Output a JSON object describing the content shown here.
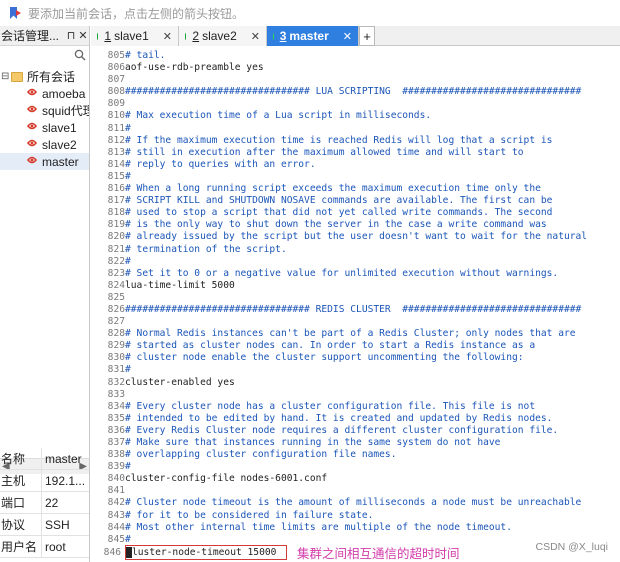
{
  "topbar": {
    "hint": "要添加当前会话，点击左侧的箭头按钮。"
  },
  "panel": {
    "title": "会话管理...",
    "pin": "⊓",
    "close": "✕",
    "root_label": "所有会话",
    "sessions": [
      "amoeba",
      "squid代理",
      "slave1",
      "slave2",
      "master"
    ],
    "props": [
      {
        "key": "名称",
        "value": "master"
      },
      {
        "key": "主机",
        "value": "192.1..."
      },
      {
        "key": "端口",
        "value": "22"
      },
      {
        "key": "协议",
        "value": "SSH"
      },
      {
        "key": "用户名",
        "value": "root"
      }
    ]
  },
  "tabs": [
    {
      "num": "1",
      "label": "slave1"
    },
    {
      "num": "2",
      "label": "slave2"
    },
    {
      "num": "3",
      "label": "master"
    }
  ],
  "tab_add": "+",
  "editor": {
    "lines": [
      {
        "n": "805",
        "t": "# tail.",
        "c": true
      },
      {
        "n": "806",
        "t": "aof-use-rdb-preamble yes",
        "c": false
      },
      {
        "n": "807",
        "t": "",
        "c": false
      },
      {
        "n": "808",
        "t": "################################ LUA SCRIPTING  ###############################",
        "c": true
      },
      {
        "n": "809",
        "t": "",
        "c": false
      },
      {
        "n": "810",
        "t": "# Max execution time of a Lua script in milliseconds.",
        "c": true
      },
      {
        "n": "811",
        "t": "#",
        "c": true
      },
      {
        "n": "812",
        "t": "# If the maximum execution time is reached Redis will log that a script is",
        "c": true
      },
      {
        "n": "813",
        "t": "# still in execution after the maximum allowed time and will start to",
        "c": true
      },
      {
        "n": "814",
        "t": "# reply to queries with an error.",
        "c": true
      },
      {
        "n": "815",
        "t": "#",
        "c": true
      },
      {
        "n": "816",
        "t": "# When a long running script exceeds the maximum execution time only the",
        "c": true
      },
      {
        "n": "817",
        "t": "# SCRIPT KILL and SHUTDOWN NOSAVE commands are available. The first can be",
        "c": true
      },
      {
        "n": "818",
        "t": "# used to stop a script that did not yet called write commands. The second",
        "c": true
      },
      {
        "n": "819",
        "t": "# is the only way to shut down the server in the case a write command was",
        "c": true
      },
      {
        "n": "820",
        "t": "# already issued by the script but the user doesn't want to wait for the natural",
        "c": true
      },
      {
        "n": "821",
        "t": "# termination of the script.",
        "c": true
      },
      {
        "n": "822",
        "t": "#",
        "c": true
      },
      {
        "n": "823",
        "t": "# Set it to 0 or a negative value for unlimited execution without warnings.",
        "c": true
      },
      {
        "n": "824",
        "t": "lua-time-limit 5000",
        "c": false
      },
      {
        "n": "825",
        "t": "",
        "c": false
      },
      {
        "n": "826",
        "t": "################################ REDIS CLUSTER  ###############################",
        "c": true
      },
      {
        "n": "827",
        "t": "",
        "c": false
      },
      {
        "n": "828",
        "t": "# Normal Redis instances can't be part of a Redis Cluster; only nodes that are",
        "c": true
      },
      {
        "n": "829",
        "t": "# started as cluster nodes can. In order to start a Redis instance as a",
        "c": true
      },
      {
        "n": "830",
        "t": "# cluster node enable the cluster support uncommenting the following:",
        "c": true
      },
      {
        "n": "831",
        "t": "#",
        "c": true
      },
      {
        "n": "832",
        "t": "cluster-enabled yes",
        "c": false
      },
      {
        "n": "833",
        "t": "",
        "c": false
      },
      {
        "n": "834",
        "t": "# Every cluster node has a cluster configuration file. This file is not",
        "c": true
      },
      {
        "n": "835",
        "t": "# intended to be edited by hand. It is created and updated by Redis nodes.",
        "c": true
      },
      {
        "n": "836",
        "t": "# Every Redis Cluster node requires a different cluster configuration file.",
        "c": true
      },
      {
        "n": "837",
        "t": "# Make sure that instances running in the same system do not have",
        "c": true
      },
      {
        "n": "838",
        "t": "# overlapping cluster configuration file names.",
        "c": true
      },
      {
        "n": "839",
        "t": "#",
        "c": true
      },
      {
        "n": "840",
        "t": "cluster-config-file nodes-6001.conf",
        "c": false
      },
      {
        "n": "841",
        "t": "",
        "c": false
      },
      {
        "n": "842",
        "t": "# Cluster node timeout is the amount of milliseconds a node must be unreachable",
        "c": true
      },
      {
        "n": "843",
        "t": "# for it to be considered in failure state.",
        "c": true
      },
      {
        "n": "844",
        "t": "# Most other internal time limits are multiple of the node timeout.",
        "c": true
      },
      {
        "n": "845",
        "t": "#",
        "c": true
      }
    ],
    "last_line_num": "846",
    "last_line_text": "luster-node-timeout 15000",
    "last_line_cursor_char": "c",
    "annotation": "集群之间相互通信的超时时间",
    "watermark": "CSDN @X_luqi"
  },
  "colors": {
    "comment": "#1c56b8",
    "active_tab": "#2f7fe0",
    "annotation": "#d33caa",
    "highlight_border": "#d23b3b"
  }
}
